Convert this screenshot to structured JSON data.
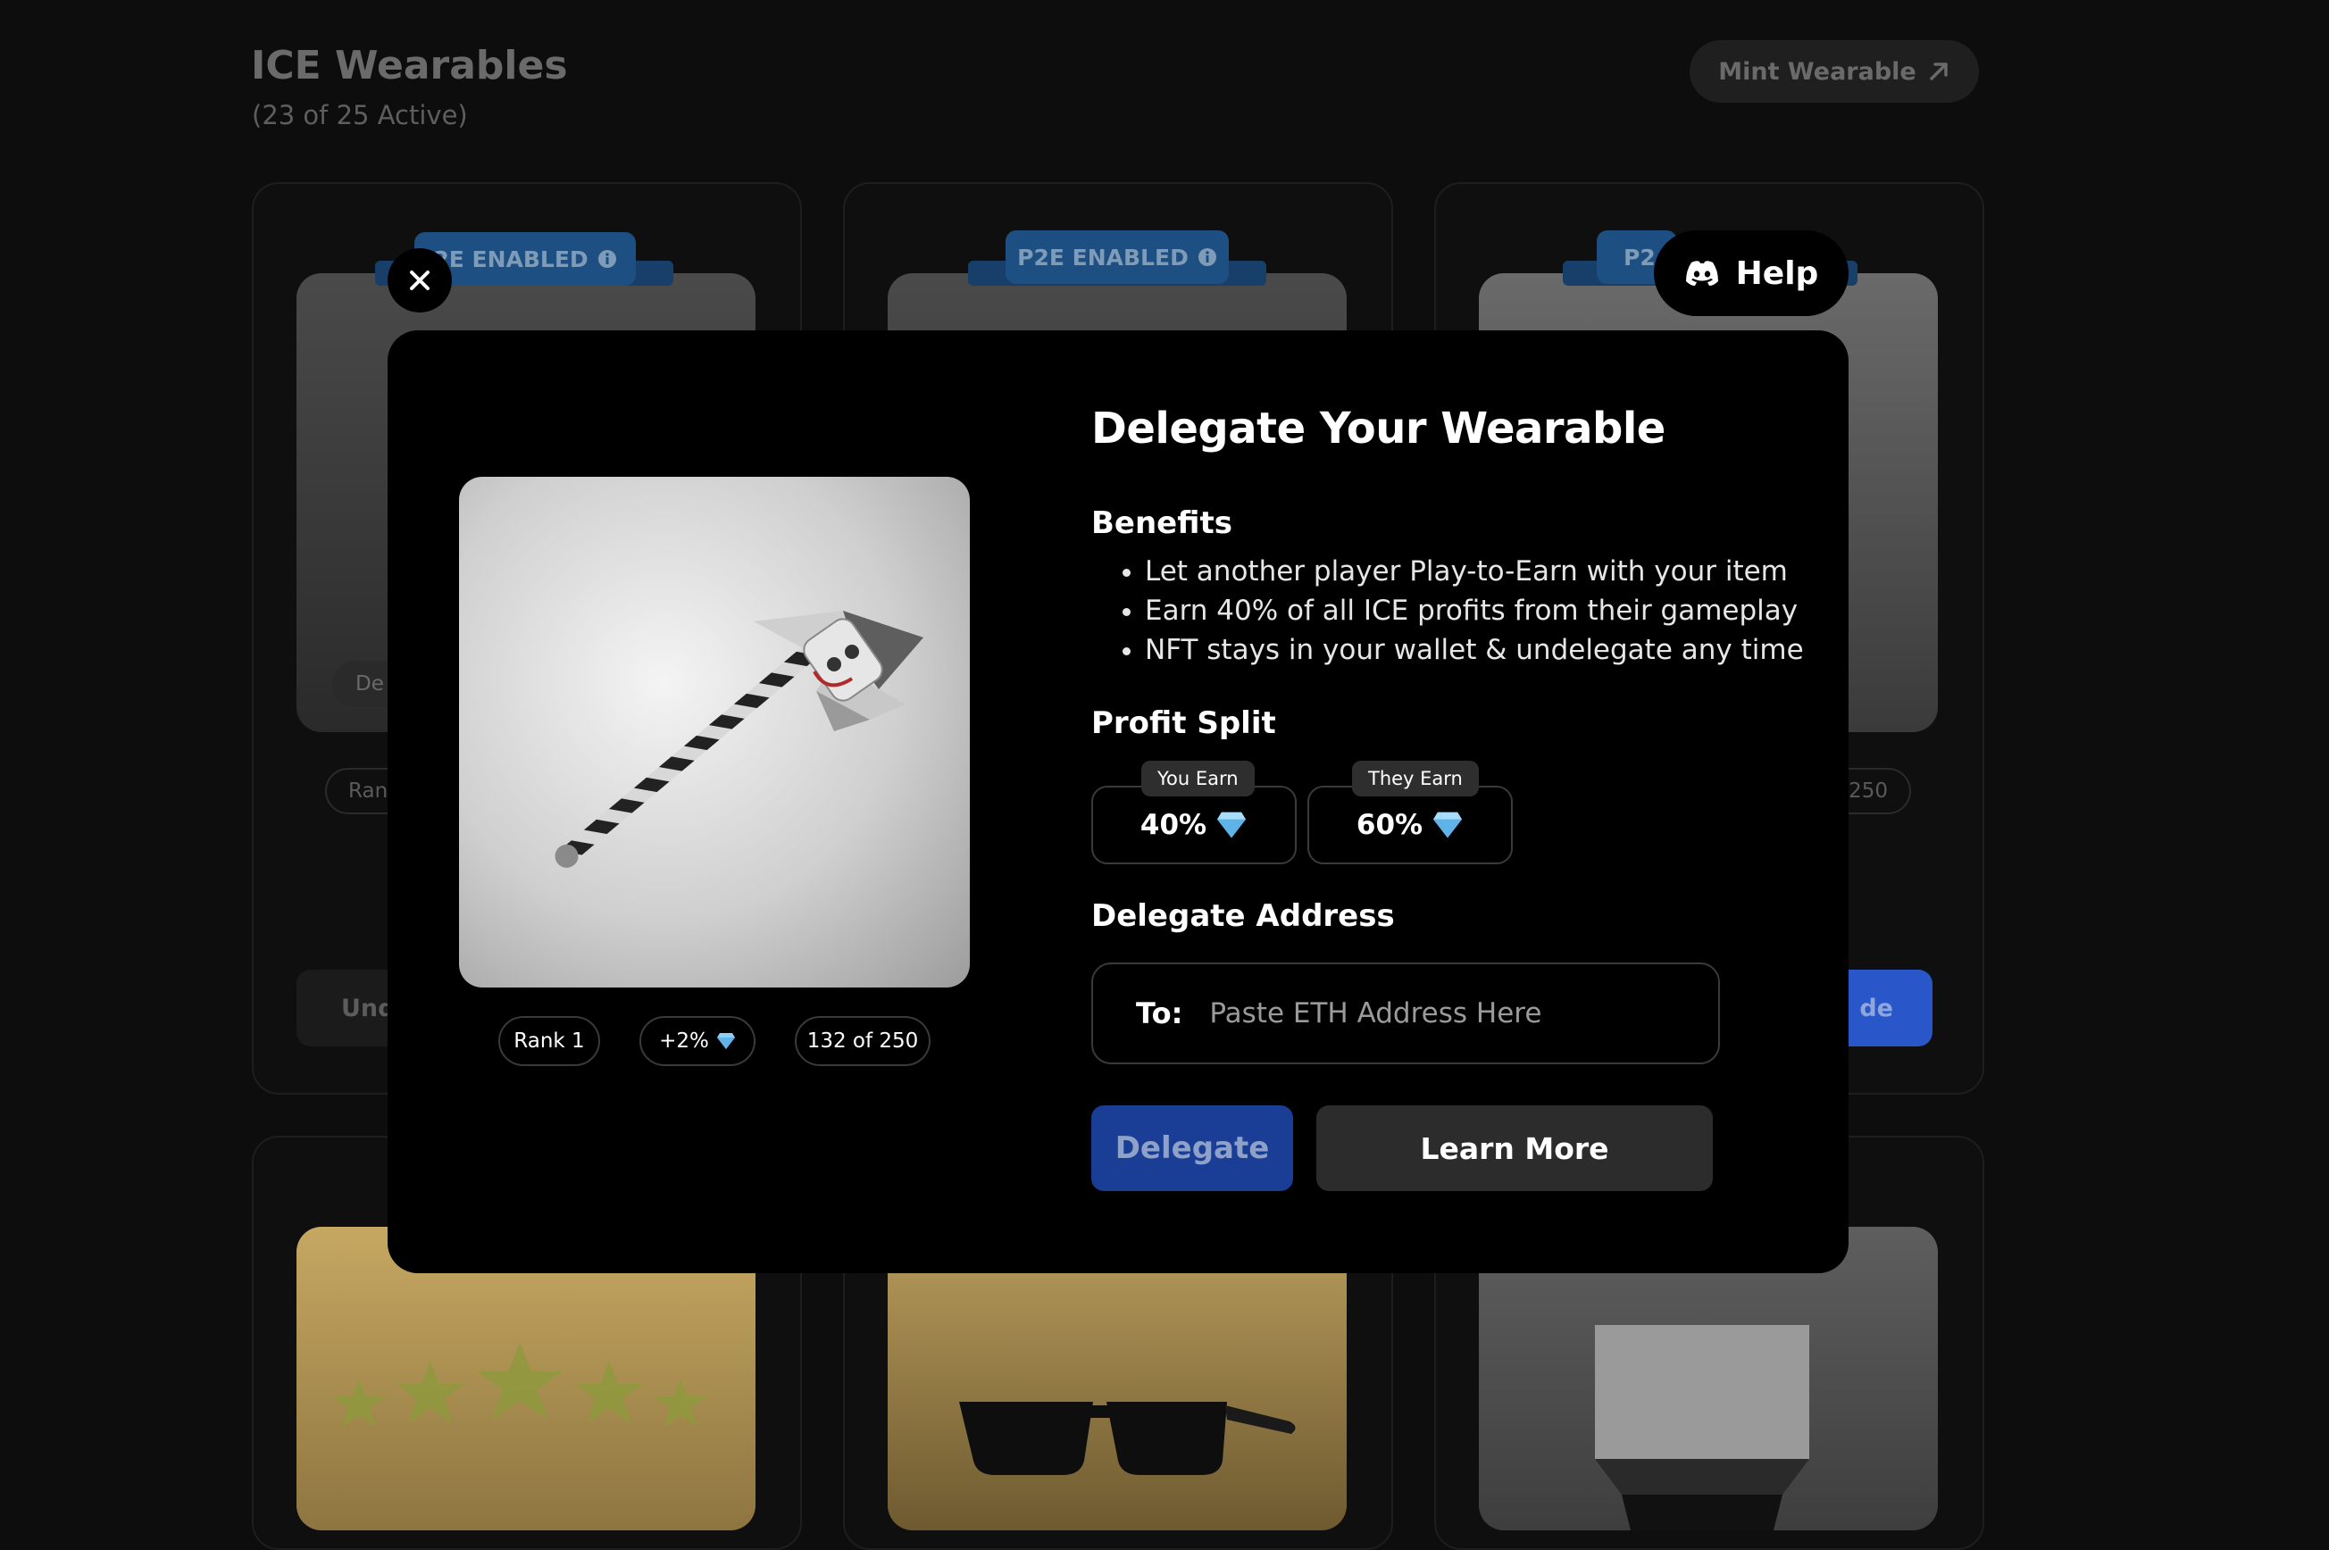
{
  "page": {
    "title": "ICE Wearables",
    "subtitle": "(23 of 25 Active)",
    "mint_label": "Mint Wearable"
  },
  "cards": {
    "banner_label": "P2E ENABLED",
    "banner_label_cut_left": "2E ENABLED",
    "banner_label_cut_right": "P2",
    "partial_delegate": "De",
    "partial_rank": "Rank",
    "partial_count": "250",
    "partial_undelegate": "Und",
    "partial_delegate_right": "de"
  },
  "modal": {
    "title": "Delegate Your Wearable",
    "benefits_heading": "Benefits",
    "benefits": [
      "Let another player Play-to-Earn with your item",
      "Earn 40% of all ICE profits from their gameplay",
      "NFT stays in your wallet & undelegate any time"
    ],
    "profit_split_heading": "Profit Split",
    "you_earn_label": "You Earn",
    "you_earn_value": "40%",
    "they_earn_label": "They Earn",
    "they_earn_value": "60%",
    "delegate_address_heading": "Delegate Address",
    "to_label": "To:",
    "address_placeholder": "Paste ETH Address Here",
    "address_value": "",
    "delegate_label": "Delegate",
    "learn_more_label": "Learn More",
    "help_label": "Help",
    "rank": "Rank 1",
    "bonus": "+2%",
    "edition": "132 of 250"
  },
  "icons": {
    "close": "close-icon",
    "help": "discord-icon",
    "gem": "diamond-icon",
    "info": "info-icon",
    "mint": "arrow-up-right-icon"
  },
  "colors": {
    "delegate_button": "#1a3d96",
    "banner": "#1e4f82",
    "gem": "#8fd0f5"
  }
}
